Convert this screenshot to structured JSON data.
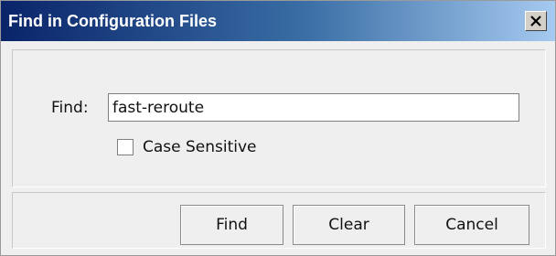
{
  "window": {
    "title": "Find in Configuration Files",
    "close_icon": "close-icon"
  },
  "form": {
    "find_label": "Find:",
    "find_value": "fast-reroute",
    "case_sensitive_label": "Case Sensitive",
    "case_sensitive_checked": false
  },
  "buttons": {
    "find_label": "Find",
    "clear_label": "Clear",
    "cancel_label": "Cancel"
  }
}
